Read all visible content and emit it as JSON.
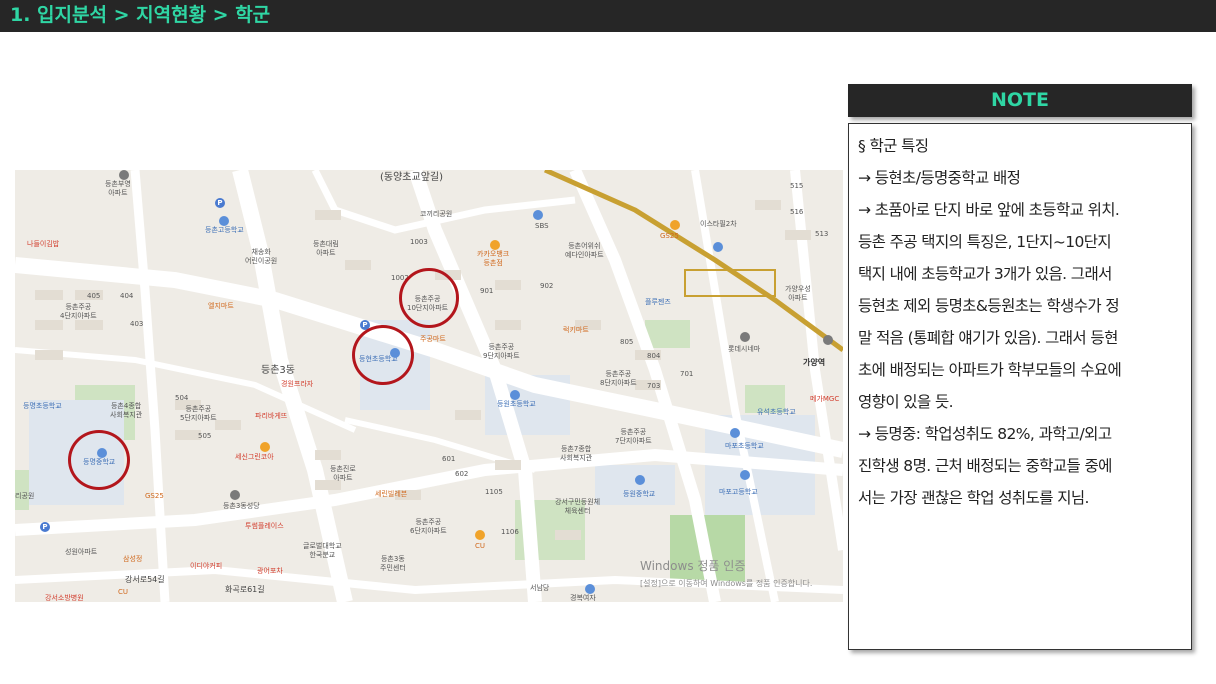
{
  "header": {
    "title": "1. 입지분석 > 지역현황 > 학군",
    "bg_color": "#262626",
    "accent_color": "#2fd6a4"
  },
  "map": {
    "labels": {
      "donganchogyo": "(동양초교앞길)",
      "coffee_park": "코끼리공원",
      "sbs": "SBS",
      "deungchon_daerim": "등촌대림\n아파트",
      "deungchon_buyoung": "등촌부영\n아파트",
      "deungchon_high": "등촌고등학교",
      "chaesong": "채송화\n어린이공원",
      "nadeul": "나들이김밥",
      "jugong4": "등촌주공\n4단지아파트",
      "elji": "엘지마트",
      "jugong10": "등촌주공\n10단지아파트",
      "kakao": "카카오뱅크\n등촌점",
      "juggong_mart": "주공마트",
      "deunghyeon_elem": "등현초등학교",
      "deungchon3": "등촌3동",
      "gyeongwon": "경원프라자",
      "jugong9": "등촌주공\n9단지아파트",
      "reokki": "럭키마트",
      "deungchon_welfare": "등촌어위쉬\n예다인아파트",
      "gs25_top": "GS25",
      "isseupark": "이스타필2차",
      "deungchon_station": "가양역",
      "flowers": "플루젠즈",
      "lotte": "롯데시네마",
      "gayang_wusung": "가양우성\n아파트",
      "jugong8": "등촌주공\n8단지아파트",
      "jugong7": "등촌주공\n7단지아파트",
      "deungwon_elem": "등원초등학교",
      "deungmyeong_elem": "등명초등학교",
      "deungmyeong_middle": "등명중학교",
      "deungchon4": "등촌4종합\n사회복지관",
      "jugong5": "등촌주공\n5단지아파트",
      "paris": "파리바게뜨",
      "sesin": "세신그린코아",
      "deungchon_jinro": "등촌진로\n아파트",
      "selin": "세린빌레븐",
      "deungchon7_welfare": "등촌7종합\n사회복지관",
      "gangseo_gym": "강서구민등원체\n체육센터",
      "jugong6": "등촌주공\n6단지아파트",
      "deungchon3_center": "등촌3동\n주민센터",
      "glory": "글로벌대학교\n한국분교",
      "mapo_high": "마포고등학교",
      "deungwon_middle": "등원중학교",
      "mapo_elem": "마포초등학교",
      "yusuk_middle": "유석초등학교",
      "gs25_bottom": "GS25",
      "cu_bottom": "CU",
      "cu_mid": "CU",
      "deungchon_seongdang": "등촌3동성당",
      "tuhwa": "투썸플레이스",
      "gwangyeo": "광어포차",
      "seowon": "성원아파트",
      "samsung": "삼성정",
      "eda": "이디야커피",
      "gangseo_hospital": "강서소방병원",
      "gangseo_road": "강서로54길",
      "seonamdang": "서남당",
      "gyeongbuk": "경복여자",
      "windows_line1": "Windows 정품 인증",
      "windows_line2": "[설정]으로 이동하여 Windows를 정품 인증합니다.",
      "ggalchi": "리공원",
      "hwagok_road": "화곡로61길",
      "numbers_a": "405",
      "numbers_b": "404",
      "numbers_c": "403",
      "numbers_d": "1003",
      "numbers_e": "1002",
      "numbers_f": "901",
      "numbers_g": "902",
      "numbers_h": "805",
      "numbers_i": "804",
      "numbers_j": "703",
      "numbers_k": "701",
      "numbers_l": "504",
      "numbers_m": "505",
      "numbers_n": "601",
      "numbers_o": "602",
      "numbers_p": "1105",
      "numbers_q": "1106",
      "numbers_r": "515",
      "numbers_s": "516",
      "numbers_t": "513",
      "mega": "메가MGC",
      "gamyang_station": "가양역"
    }
  },
  "note": {
    "header": "NOTE",
    "lines": [
      "§ 학군 특징",
      "→ 등현초/등명중학교 배정",
      "→ 초품아로 단지 바로 앞에 초등학교 위치.",
      "등촌 주공 택지의 특징은, 1단지~10단지",
      "택지 내에 초등학교가 3개가 있음. 그래서",
      "등현초 제외 등명초&등원초는 학생수가 정",
      "말 적음 (통폐합 얘기가 있음). 그래서 등현",
      "초에 배정되는 아파트가 학부모들의 수요에",
      "영향이 있을 듯.",
      "→ 등명중: 학업성취도 82%, 과학고/외고",
      "진학생 8명. 근처 배정되는 중학교들 중에",
      "서는 가장 괜찮은 학업 성취도를 지님."
    ]
  },
  "colors": {
    "circle": "#b3161c",
    "map_bg": "#efece6",
    "road": "#ffffff",
    "subway": "#c8a032"
  }
}
